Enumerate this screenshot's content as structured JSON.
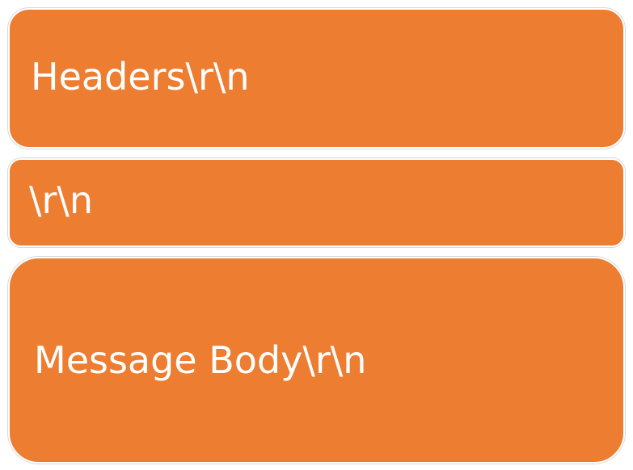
{
  "blocks": [
    {
      "label": "Headers\\r\\n"
    },
    {
      "label": "\\r\\n"
    },
    {
      "label": "Message Body\\r\\n"
    }
  ],
  "colors": {
    "block_fill": "#ED7D31",
    "text": "#FFFFFF",
    "background": "#FFFFFF"
  }
}
